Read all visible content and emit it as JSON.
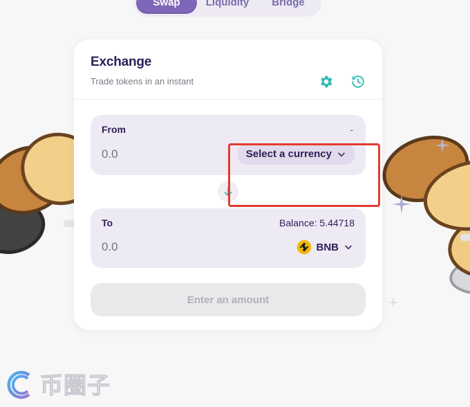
{
  "colors": {
    "page_bg": "#f7f7f8",
    "card_bg": "#ffffff",
    "panel_bg": "#eeeaf4",
    "accent_purple": "#7e66b8",
    "accent_teal": "#31bab4",
    "title_navy": "#2d2058",
    "annotation_red": "#e23b2e",
    "bnb_yellow": "#f0b90b"
  },
  "tabs": [
    {
      "label": "Swap",
      "active": true
    },
    {
      "label": "Liquidity",
      "active": false
    },
    {
      "label": "Bridge",
      "active": false
    }
  ],
  "card": {
    "title": "Exchange",
    "subtitle": "Trade tokens in an instant",
    "actions": [
      {
        "name": "settings-icon",
        "label": "gear-icon"
      },
      {
        "name": "history-icon",
        "label": "history-clock-icon"
      }
    ]
  },
  "from_panel": {
    "label": "From",
    "right_meta": "-",
    "amount_value": "0.0",
    "amount_placeholder": "0.0",
    "currency_label": "Select a currency",
    "has_token": false
  },
  "swap_arrow": {
    "icon": "arrow-down-icon"
  },
  "to_panel": {
    "label": "To",
    "right_meta": "Balance: 5.44718",
    "amount_value": "0.0",
    "amount_placeholder": "0.0",
    "currency_label": "BNB",
    "token_icon": "bnb-token-icon",
    "has_token": true
  },
  "cta": {
    "label": "Enter an amount",
    "disabled": true
  },
  "annotation": {
    "type": "red-rectangle-highlight",
    "target": "select-a-currency-dropdown"
  },
  "watermark": {
    "text": "币圈子",
    "logo": "circular-swirl-logo"
  }
}
